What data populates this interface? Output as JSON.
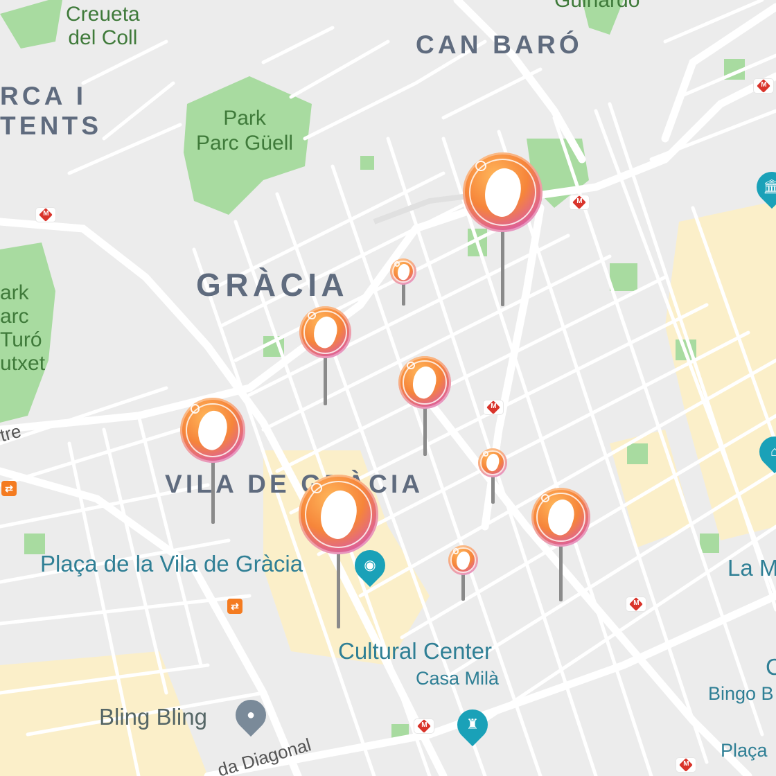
{
  "labels": {
    "creueta_line1": "Creueta",
    "creueta_line2": "del Coll",
    "guinardo": "Guinardó",
    "can_baro": "CAN BARÓ",
    "carmel_line1": "RCA I",
    "carmel_line2": "TENTS",
    "park_guell_line1": "Park",
    "park_guell_line2": "Parc Güell",
    "gracia": "GRÀCIA",
    "turo_line1": "ark",
    "turo_line2": "arc",
    "turo_line3": "Turó",
    "turo_line4": "utxet",
    "vila_de_gracia": "VILA DE GRÀCIA",
    "placa_vila": "Plaça de la Vila de Gràcia",
    "cultural_center": "Cultural Center",
    "casa_mila": "Casa Milà",
    "bling_bling": "Bling Bling",
    "la_m": "La M",
    "bingo": "Bingo B",
    "c_partial": "C",
    "placa_right": "Plaça",
    "diagonal": "da Diagonal",
    "tre": "tre"
  },
  "icons": {
    "metro": "metro-icon",
    "rail": "rail-icon",
    "museum": "museum-icon",
    "camera": "camera-icon",
    "location": "location-pin-icon",
    "landmark": "landmark-icon",
    "custom_pin": "footprint-pin-icon"
  },
  "colors": {
    "road": "#ffffff",
    "park": "#a8dba0",
    "land": "#ececec",
    "tourist_area": "#fbefc9",
    "poi_pin": "#1aa1b8"
  }
}
